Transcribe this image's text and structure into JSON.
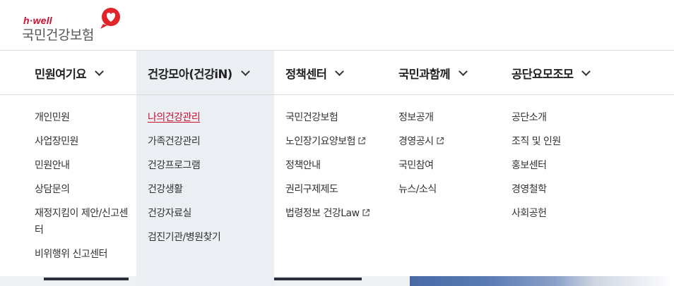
{
  "logo": {
    "sub": "h·well",
    "main": "국민건강보험",
    "heart_color": "#e2242b"
  },
  "colors": {
    "accent": "#c8102e",
    "active_bg": "#ebeef2"
  },
  "gnb": [
    {
      "label": "민원여기요",
      "icon": "chevron-down-icon"
    },
    {
      "label": "건강모아(건강iN)",
      "icon": "chevron-down-icon",
      "active": true
    },
    {
      "label": "정책센터",
      "icon": "chevron-down-icon"
    },
    {
      "label": "국민과함께",
      "icon": "chevron-down-icon"
    },
    {
      "label": "공단요모조모",
      "icon": "chevron-down-icon"
    }
  ],
  "submenu": {
    "col1": [
      "개인민원",
      "사업장민원",
      "민원안내",
      "상담문의",
      "재정지킴이 제안/신고센터",
      "비위행위 신고센터"
    ],
    "col2": [
      "나의건강관리",
      "가족건강관리",
      "건강프로그램",
      "건강생활",
      "건강자료실",
      "검진기관/병원찾기"
    ],
    "col3": [
      "국민건강보험",
      "노인장기요양보험",
      "정책안내",
      "권리구제제도",
      "법령정보 건강Law"
    ],
    "col4": [
      "정보공개",
      "경영공시",
      "국민참여",
      "뉴스/소식"
    ],
    "col5": [
      "공단소개",
      "조직 및 인원",
      "홍보센터",
      "경영철학",
      "사회공헌"
    ]
  }
}
